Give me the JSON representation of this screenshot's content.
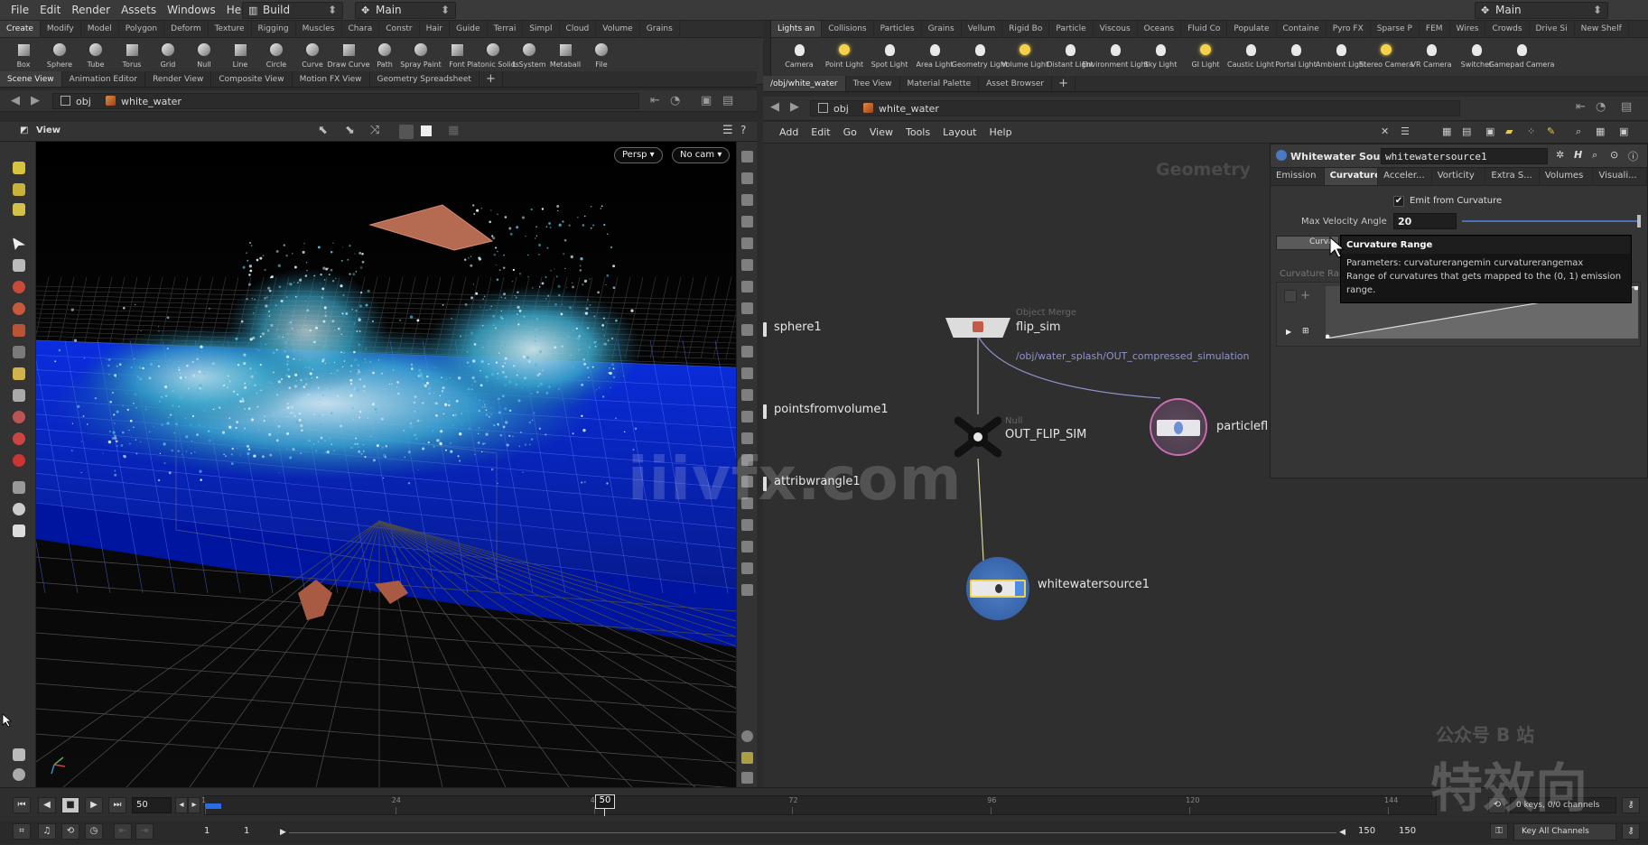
{
  "menubar": {
    "items": [
      "File",
      "Edit",
      "Render",
      "Assets",
      "Windows",
      "Help"
    ],
    "desktop": "Build",
    "network_context": "Main",
    "right_context": "Main"
  },
  "shelf_left": {
    "tabs": [
      "Create",
      "Modify",
      "Model",
      "Polygon",
      "Deform",
      "Texture",
      "Rigging",
      "Muscles",
      "Chara",
      "Constr",
      "Hair",
      "Guide",
      "Terrai",
      "Simpl",
      "Cloud",
      "Volume",
      "Grains"
    ],
    "tools": [
      "Box",
      "Sphere",
      "Tube",
      "Torus",
      "Grid",
      "Null",
      "Line",
      "Circle",
      "Curve",
      "Draw Curve",
      "Path",
      "Spray Paint",
      "Font",
      "Platonic Solids",
      "L-System",
      "Metaball",
      "File"
    ]
  },
  "shelf_right": {
    "tabs": [
      "Lights an",
      "Collisions",
      "Particles",
      "Grains",
      "Vellum",
      "Rigid Bo",
      "Particle",
      "Viscous",
      "Oceans",
      "Fluid Co",
      "Populate",
      "Containe",
      "Pyro FX",
      "Sparse P",
      "FEM",
      "Wires",
      "Crowds",
      "Drive Si",
      "New Shelf"
    ],
    "tools": [
      "Camera",
      "Point Light",
      "Spot Light",
      "Area Light",
      "Geometry Light",
      "Volume Light",
      "Distant Light",
      "Environment Light",
      "Sky Light",
      "GI Light",
      "Caustic Light",
      "Portal Light",
      "Ambient Light",
      "Stereo Camera",
      "VR Camera",
      "Switcher",
      "Gamepad Camera"
    ]
  },
  "left_pane": {
    "tabs": [
      "Scene View",
      "Animation Editor",
      "Render View",
      "Composite View",
      "Motion FX View",
      "Geometry Spreadsheet"
    ],
    "path": [
      "obj",
      "white_water"
    ],
    "view_label": "View",
    "persp_button": "Persp",
    "cam_button": "No cam"
  },
  "right_pane": {
    "tabs": [
      "/obj/white_water",
      "Tree View",
      "Material Palette",
      "Asset Browser"
    ],
    "path": [
      "obj",
      "white_water"
    ],
    "menus": [
      "Add",
      "Edit",
      "Go",
      "View",
      "Tools",
      "Layout",
      "Help"
    ],
    "context_label": "Geometry"
  },
  "network": {
    "side_nodes": [
      "sphere1",
      "pointsfromvolume1",
      "attribwrangle1"
    ],
    "flip_sim": {
      "type": "Object Merge",
      "name": "flip_sim",
      "comment": "/obj/water_splash/OUT_compressed_simulation"
    },
    "out_flip_sim": {
      "type": "Null",
      "name": "OUT_FLIP_SIM"
    },
    "particlefluid": {
      "name": "particlefl"
    },
    "whitewatersource": {
      "name": "whitewatersource1"
    }
  },
  "params": {
    "node_type": "Whitewater Source",
    "node_name": "whitewatersource1",
    "tabs": [
      "Emission",
      "Curvature",
      "Acceler...",
      "Vorticity",
      "Extra S...",
      "Volumes",
      "Visuali..."
    ],
    "active_tab": "Curvature",
    "emit_from_curvature_label": "Emit from Curvature",
    "emit_from_curvature_checked": true,
    "max_velocity_angle_label": "Max Velocity Angle",
    "max_velocity_angle_value": "20",
    "curvature_button_label": "Curva",
    "curvature_ramp_label": "Curvature Ramp",
    "tooltip": {
      "title": "Curvature Range",
      "parameters": "Parameters: curvaturerangemin curvaturerangemax",
      "description": "Range of curvatures that gets mapped to the (0, 1) emission range."
    }
  },
  "timeline": {
    "current_frame": "50",
    "frame_marker": "50",
    "ticks": [
      "1",
      "24",
      "48",
      "72",
      "96",
      "120",
      "144"
    ],
    "start_frame": "1",
    "start_frame_2": "1",
    "end_frame": "150",
    "end_frame_2": "150",
    "keys_info": "0 keys, 0/0 channels",
    "key_all_channels": "Key All Channels"
  },
  "watermarks": {
    "site": "iiivfx.com",
    "wechat": "公众号 B 站",
    "brand": "特效向"
  },
  "colors": {
    "water_blue": "#0a2ee0",
    "splash_cyan": "#3aa7c9",
    "node_selected_ring": "#f2d24a",
    "comment_purple": "#8f95c9"
  }
}
